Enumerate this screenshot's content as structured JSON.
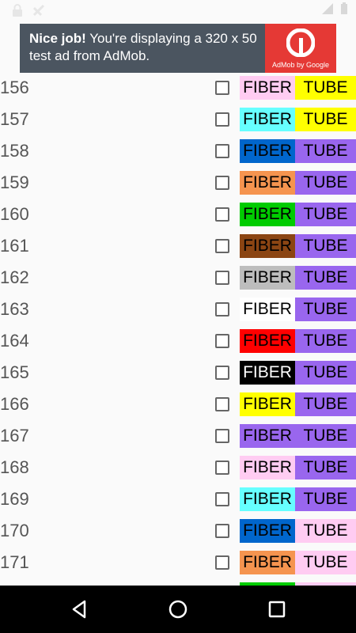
{
  "ad": {
    "headline": "Nice job!",
    "message": "You're displaying a 320 x 50 test ad from AdMob.",
    "brand": "AdMob by Google"
  },
  "colors": {
    "pink": "#ffccf2",
    "aqua": "#66ffff",
    "blue": "#0066cc",
    "orange": "#f5944f",
    "green": "#00cc00",
    "brown": "#8b4513",
    "slate": "#bdbdbd",
    "white": "#ffffff",
    "red": "#ff0000",
    "black": "#000000",
    "yellow": "#ffff00",
    "violet": "#9966ee"
  },
  "rows": [
    {
      "number": "156",
      "fiber_label": "FIBER",
      "tube_label": "TUBE",
      "fiber_color": "pink",
      "tube_color": "yellow"
    },
    {
      "number": "157",
      "fiber_label": "FIBER",
      "tube_label": "TUBE",
      "fiber_color": "aqua",
      "tube_color": "yellow"
    },
    {
      "number": "158",
      "fiber_label": "FIBER",
      "tube_label": "TUBE",
      "fiber_color": "blue",
      "tube_color": "violet"
    },
    {
      "number": "159",
      "fiber_label": "FIBER",
      "tube_label": "TUBE",
      "fiber_color": "orange",
      "tube_color": "violet"
    },
    {
      "number": "160",
      "fiber_label": "FIBER",
      "tube_label": "TUBE",
      "fiber_color": "green",
      "tube_color": "violet"
    },
    {
      "number": "161",
      "fiber_label": "FIBER",
      "tube_label": "TUBE",
      "fiber_color": "brown",
      "tube_color": "violet"
    },
    {
      "number": "162",
      "fiber_label": "FIBER",
      "tube_label": "TUBE",
      "fiber_color": "slate",
      "tube_color": "violet"
    },
    {
      "number": "163",
      "fiber_label": "FIBER",
      "tube_label": "TUBE",
      "fiber_color": "white",
      "tube_color": "violet"
    },
    {
      "number": "164",
      "fiber_label": "FIBER",
      "tube_label": "TUBE",
      "fiber_color": "red",
      "tube_color": "violet"
    },
    {
      "number": "165",
      "fiber_label": "FIBER",
      "tube_label": "TUBE",
      "fiber_color": "black",
      "tube_color": "violet"
    },
    {
      "number": "166",
      "fiber_label": "FIBER",
      "tube_label": "TUBE",
      "fiber_color": "yellow",
      "tube_color": "violet"
    },
    {
      "number": "167",
      "fiber_label": "FIBER",
      "tube_label": "TUBE",
      "fiber_color": "violet",
      "tube_color": "violet"
    },
    {
      "number": "168",
      "fiber_label": "FIBER",
      "tube_label": "TUBE",
      "fiber_color": "pink",
      "tube_color": "violet"
    },
    {
      "number": "169",
      "fiber_label": "FIBER",
      "tube_label": "TUBE",
      "fiber_color": "aqua",
      "tube_color": "violet"
    },
    {
      "number": "170",
      "fiber_label": "FIBER",
      "tube_label": "TUBE",
      "fiber_color": "blue",
      "tube_color": "pink"
    },
    {
      "number": "171",
      "fiber_label": "FIBER",
      "tube_label": "TUBE",
      "fiber_color": "orange",
      "tube_color": "pink"
    },
    {
      "number": "",
      "fiber_label": "",
      "tube_label": "",
      "fiber_color": "green",
      "tube_color": "pink"
    }
  ]
}
